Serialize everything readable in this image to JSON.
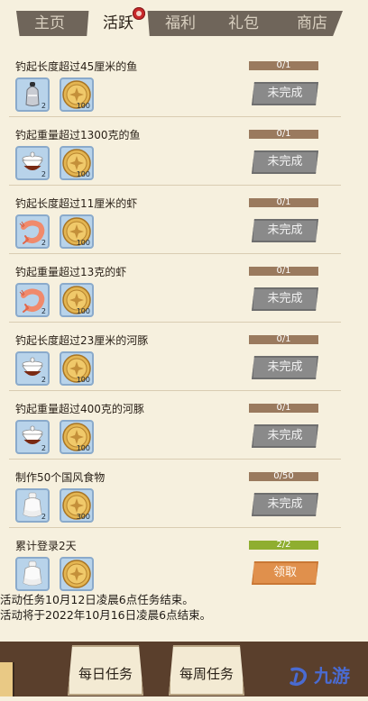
{
  "tabs": [
    {
      "label": "主页"
    },
    {
      "label": "活跃"
    },
    {
      "label": "福利"
    },
    {
      "label": "礼包"
    },
    {
      "label": "商店"
    }
  ],
  "active_tab": "活跃",
  "tasks": [
    {
      "title": "钓起长度超过45厘米的鱼",
      "progress_text": "0/1",
      "progress": 0,
      "status": "未完成",
      "rewards": [
        {
          "icon": "salt-shaker-icon",
          "count": "2"
        },
        {
          "icon": "coin-icon",
          "count": "100"
        }
      ]
    },
    {
      "title": "钓起重量超过1300克的鱼",
      "progress_text": "0/1",
      "progress": 0,
      "status": "未完成",
      "rewards": [
        {
          "icon": "sauce-bowl-icon",
          "count": "2"
        },
        {
          "icon": "coin-icon",
          "count": "100"
        }
      ]
    },
    {
      "title": "钓起长度超过11厘米的虾",
      "progress_text": "0/1",
      "progress": 0,
      "status": "未完成",
      "rewards": [
        {
          "icon": "shrimp-icon",
          "count": "2"
        },
        {
          "icon": "coin-icon",
          "count": "100"
        }
      ]
    },
    {
      "title": "钓起重量超过13克的虾",
      "progress_text": "0/1",
      "progress": 0,
      "status": "未完成",
      "rewards": [
        {
          "icon": "shrimp-icon",
          "count": "2"
        },
        {
          "icon": "coin-icon",
          "count": "100"
        }
      ]
    },
    {
      "title": "钓起长度超过23厘米的河豚",
      "progress_text": "0/1",
      "progress": 0,
      "status": "未完成",
      "rewards": [
        {
          "icon": "sauce-bowl-icon",
          "count": "2"
        },
        {
          "icon": "coin-icon",
          "count": "100"
        }
      ]
    },
    {
      "title": "钓起重量超过400克的河豚",
      "progress_text": "0/1",
      "progress": 0,
      "status": "未完成",
      "rewards": [
        {
          "icon": "sauce-bowl-icon",
          "count": "2"
        },
        {
          "icon": "coin-icon",
          "count": "100"
        }
      ]
    },
    {
      "title": "制作50个国风食物",
      "progress_text": "0/50",
      "progress": 0,
      "status": "未完成",
      "rewards": [
        {
          "icon": "milk-jar-icon",
          "count": "2"
        },
        {
          "icon": "coin-icon",
          "count": "300"
        }
      ]
    },
    {
      "title": "累计登录2天",
      "progress_text": "2/2",
      "progress": 1,
      "status": "领取",
      "rewards": [
        {
          "icon": "milk-jar-icon",
          "count": ""
        },
        {
          "icon": "coin-icon",
          "count": ""
        }
      ]
    }
  ],
  "notice": {
    "line1": "活动任务10月12日凌晨6点任务结束。",
    "line2": "活动将于2022年10月16日凌晨6点结束。"
  },
  "bottom": {
    "daily_label": "每日任务",
    "weekly_label": "每周任务"
  },
  "watermark": {
    "text": "九游"
  },
  "colors": {
    "progress_track": "#9a7a5e",
    "progress_fill": "#8fae30",
    "button_incomplete": "#8a8a8a",
    "button_claim": "#e0904c"
  }
}
